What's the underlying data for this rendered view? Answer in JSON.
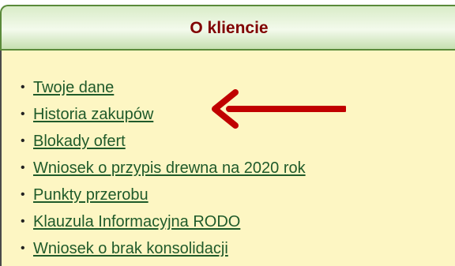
{
  "panel": {
    "title": "O kliencie"
  },
  "menu": {
    "items": [
      {
        "label": "Twoje dane"
      },
      {
        "label": "Historia zakupów"
      },
      {
        "label": "Blokady ofert"
      },
      {
        "label": "Wniosek o przypis drewna na 2020 rok"
      },
      {
        "label": "Punkty przerobu"
      },
      {
        "label": "Klauzula Informacyjna RODO"
      },
      {
        "label": "Wniosek o brak konsolidacji"
      }
    ]
  },
  "annotation": {
    "icon": "left-arrow-icon",
    "color": "#c00000"
  },
  "colors": {
    "title": "#800000",
    "link": "#1f5a2a",
    "panel_background": "#fdf6c3",
    "header_border": "#5a8a3a"
  }
}
